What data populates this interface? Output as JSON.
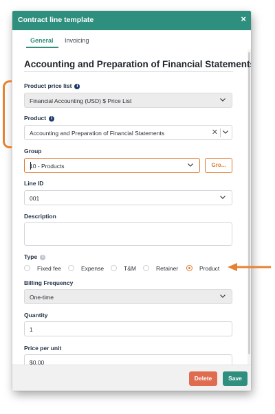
{
  "header": {
    "title": "Contract line template",
    "close_symbol": "×"
  },
  "tabs": [
    {
      "label": "General",
      "active": true
    },
    {
      "label": "Invoicing",
      "active": false
    }
  ],
  "record_title": "Accounting and Preparation of Financial Statements",
  "fields": {
    "product_price_list": {
      "label": "Product price list",
      "value": "Financial Accounting (USD) $ Price List"
    },
    "product": {
      "label": "Product",
      "value": "Accounting and Preparation of Financial Statements"
    },
    "group": {
      "label": "Group",
      "value": "10 - Products",
      "button_label": "Gro..."
    },
    "line_id": {
      "label": "Line ID",
      "value": "001"
    },
    "description": {
      "label": "Description",
      "value": ""
    },
    "type": {
      "label": "Type",
      "options": [
        "Fixed fee",
        "Expense",
        "T&M",
        "Retainer",
        "Product"
      ],
      "selected": "Product"
    },
    "billing_frequency": {
      "label": "Billing Frequency",
      "value": "One-time"
    },
    "quantity": {
      "label": "Quantity",
      "value": "1"
    },
    "price_per_unit": {
      "label": "Price per unit",
      "value": "$0.00"
    }
  },
  "footer": {
    "delete_label": "Delete",
    "save_label": "Save"
  },
  "colors": {
    "accent": "#2f8f7e",
    "highlight": "#e0782c",
    "delete": "#e06c50"
  },
  "icons": {
    "info": "info-icon",
    "chevron": "chevron-down-icon",
    "clear": "clear-icon",
    "close": "close-icon"
  }
}
